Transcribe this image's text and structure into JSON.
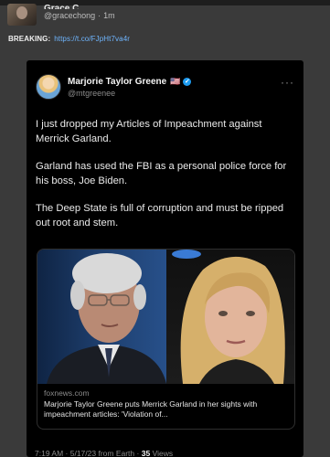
{
  "post": {
    "author_name": "Grace C",
    "handle": "@gracechong",
    "separator": "·",
    "time": "1m",
    "lead": "BREAKING:",
    "link": "https://t.co/FJpHt7va4r"
  },
  "embed": {
    "name": "Marjorie Taylor Greene",
    "flag": "🇺🇸",
    "verified_glyph": "✓",
    "handle": "@mtgreenee",
    "more": "···",
    "paragraphs": [
      "I just dropped my Articles of Impeachment against Merrick Garland.",
      "Garland has used the FBI as a personal police force for his boss, Joe Biden.",
      "The Deep State is full of corruption and must be ripped out root and stem."
    ],
    "card": {
      "domain": "foxnews.com",
      "title": "Marjorie Taylor Greene puts Merrick Garland in her sights with impeachment articles: 'Violation of..."
    },
    "footer": {
      "time": "7:19 AM · 5/17/23 from Earth",
      "sep": "·",
      "views_count": "35",
      "views_label": "Views"
    }
  },
  "colors": {
    "link": "#6fb6ff",
    "verified": "#1d9bf0",
    "background": "#3a3a3a",
    "embed_bg": "#000000"
  }
}
